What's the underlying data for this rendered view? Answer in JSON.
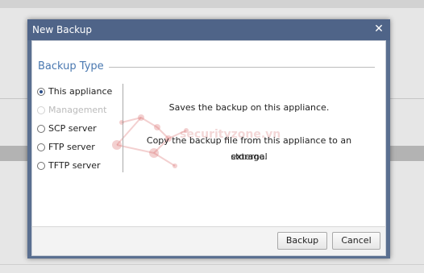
{
  "dialog": {
    "title": "New Backup",
    "close_glyph": "✕"
  },
  "section": {
    "title": "Backup Type"
  },
  "options": [
    {
      "label": "This appliance",
      "checked": true,
      "disabled": false
    },
    {
      "label": "Management",
      "checked": false,
      "disabled": true
    },
    {
      "label": "SCP server",
      "checked": false,
      "disabled": false
    },
    {
      "label": "FTP server",
      "checked": false,
      "disabled": false
    },
    {
      "label": "TFTP server",
      "checked": false,
      "disabled": false
    }
  ],
  "description": {
    "line1": "Saves the backup on this appliance.",
    "line2a": "Copy the backup file from this appliance to an external",
    "line2b": "storage."
  },
  "watermark": {
    "text": "securityzone.vn"
  },
  "footer": {
    "backup_label": "Backup",
    "cancel_label": "Cancel"
  },
  "colors": {
    "titlebar": "#4f6488",
    "section_title": "#4a78b0"
  }
}
